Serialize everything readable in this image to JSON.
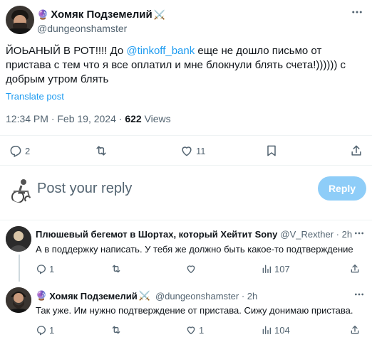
{
  "tweet": {
    "author_emoji": "🔮",
    "author_name": "Хомяк Подземелий",
    "author_badge": "⚔️",
    "handle": "@dungeonshamster",
    "text_before": "ЙОЬАНЫЙ В РОТ!!!! До ",
    "mention": "@tinkoff_bank",
    "text_after": " еще не дошло письмо от пристава с тем что я все оплатил и мне блокнули блять счета!)))))) с добрым утром блять",
    "translate": "Translate post",
    "time": "12:34 PM · Feb 19, 2024",
    "views_count": "622",
    "views_label": "Views",
    "replies": "2",
    "likes": "11"
  },
  "reply_box": {
    "placeholder": "Post your reply",
    "button": "Reply"
  },
  "comments": [
    {
      "name": "Плюшевый бегемот в Шортах, который Хейтит Sony",
      "handle": "@V_Rexther · 2h",
      "text": "А в поддержку написать. У тебя же должно быть какое-то подтверждение",
      "replies": "1",
      "likes": "",
      "views": "107"
    },
    {
      "emoji": "🔮",
      "name": "Хомяк Подземелий",
      "badge": "⚔️",
      "handle": "@dungeonshamster · 2h",
      "text": "Так уже. Им нужно подтверждение от пристава. Сижу донимаю пристава.",
      "replies": "1",
      "likes": "1",
      "views": "104"
    }
  ],
  "icons": {
    "more": "more-icon",
    "reply": "reply-icon",
    "repost": "repost-icon",
    "like": "like-icon",
    "bookmark": "bookmark-icon",
    "share": "share-icon",
    "views": "views-icon"
  },
  "colors": {
    "accent": "#1d9bf0",
    "reply_button": "#8ecdf8",
    "muted": "#536471"
  }
}
